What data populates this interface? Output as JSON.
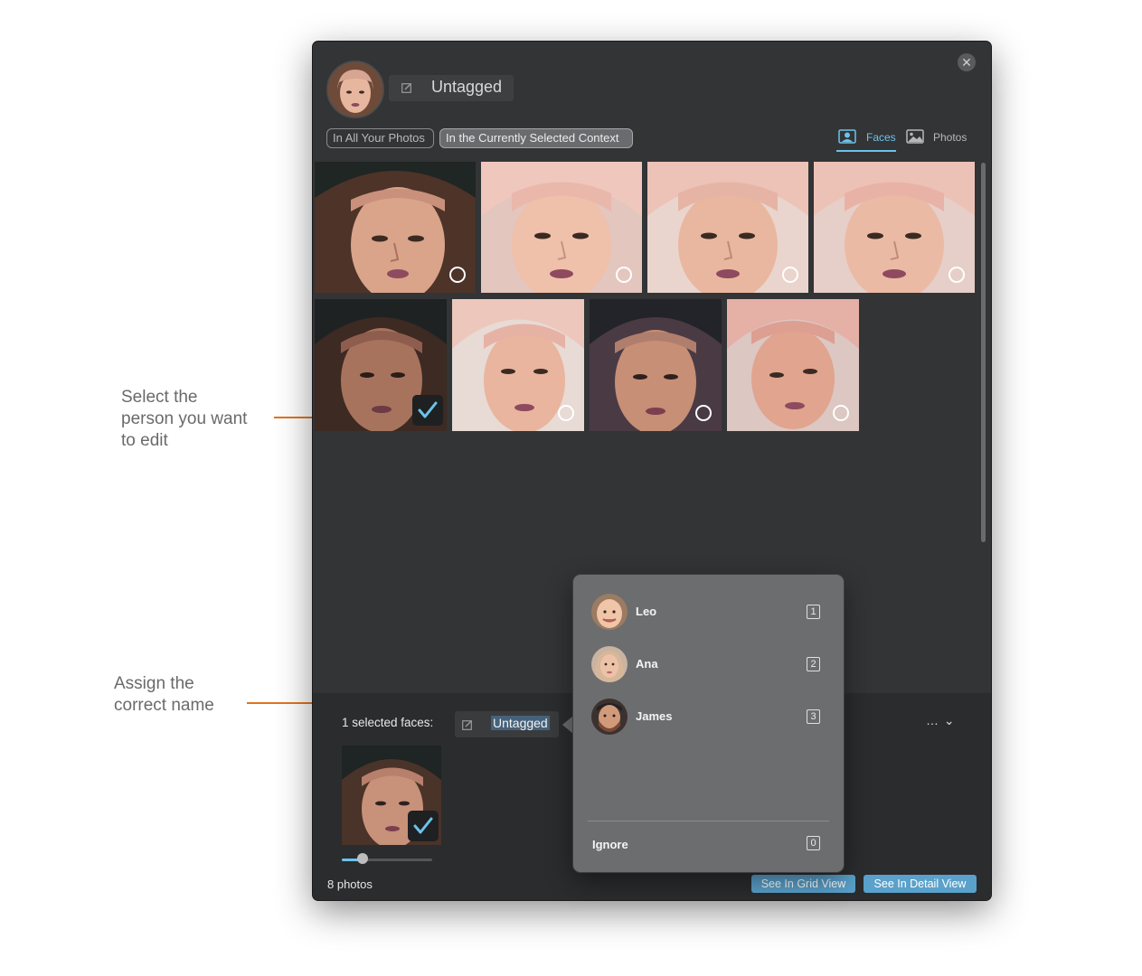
{
  "annotations": {
    "select_person": [
      "Select the",
      "person you want",
      "to edit"
    ],
    "assign_name": [
      "Assign the",
      "correct name"
    ]
  },
  "header": {
    "close_icon": "close-icon",
    "title": "Untagged",
    "edit_icon": "edit-icon"
  },
  "scope": {
    "all_photos": "In All Your Photos",
    "selected_context": "In the Currently Selected Context",
    "active": "selected_context"
  },
  "view_tabs": {
    "faces": "Faces",
    "photos": "Photos",
    "active": "faces"
  },
  "faces_grid": {
    "rows": [
      [
        {
          "selected": false,
          "hat": true
        },
        {
          "selected": false
        },
        {
          "selected": false
        },
        {
          "selected": false
        }
      ],
      [
        {
          "selected": true,
          "hat": true
        },
        {
          "selected": false
        },
        {
          "selected": false,
          "hat": true
        },
        {
          "selected": false
        }
      ]
    ]
  },
  "bottom": {
    "selected_label": "1 selected faces:",
    "name_value": "Untagged",
    "more_label": "… ⌄",
    "photo_count": "8 photos",
    "grid_view_button": "See In Grid View",
    "detail_view_button": "See In Detail View"
  },
  "popover": {
    "people": [
      {
        "name": "Leo",
        "shortcut": "1"
      },
      {
        "name": "Ana",
        "shortcut": "2"
      },
      {
        "name": "James",
        "shortcut": "3"
      }
    ],
    "ignore_label": "Ignore",
    "ignore_shortcut": "0"
  },
  "colors": {
    "accent": "#6bc3ea",
    "annotation": "#e2731f",
    "window_bg": "#333436",
    "button_blue": "#5aa1cb"
  }
}
